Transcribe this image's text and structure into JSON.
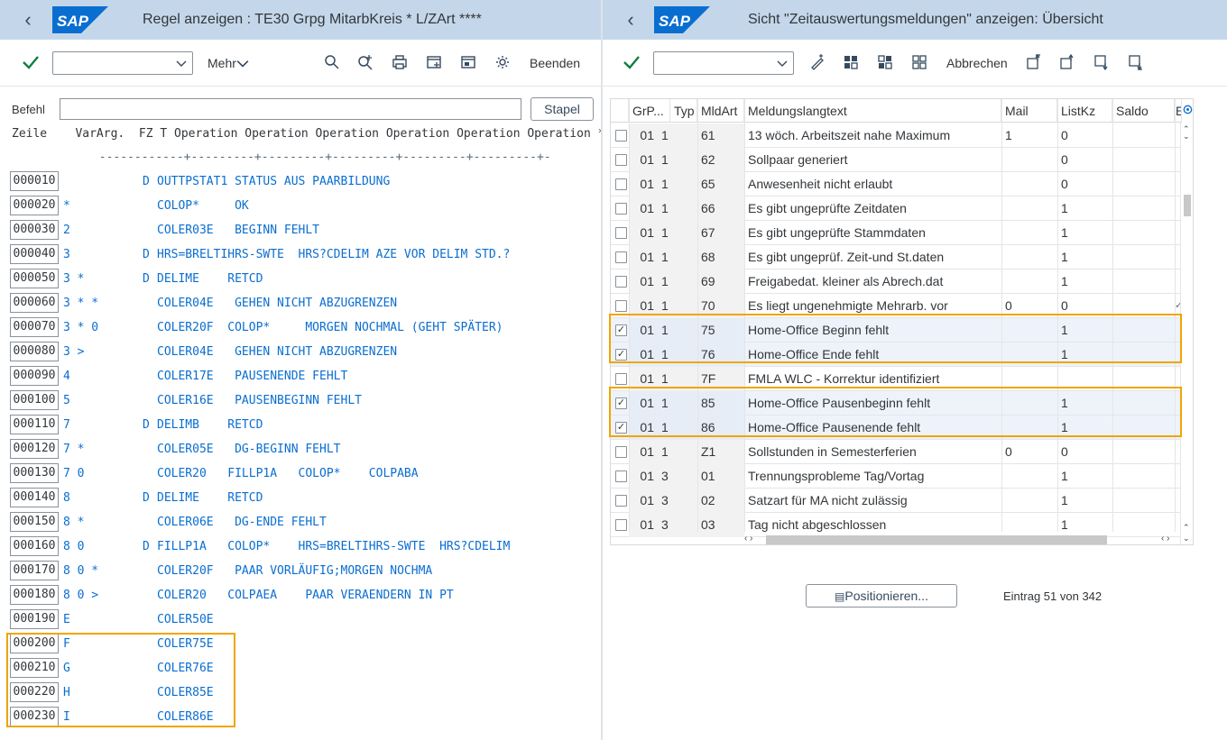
{
  "left": {
    "title": "Regel anzeigen : TE30 Grpg MitarbKreis * L/ZArt ****",
    "toolbar": {
      "more_label": "Mehr",
      "exit_label": "Beenden"
    },
    "command_label": "Befehl",
    "stapel_label": "Stapel",
    "header_line": "Zeile    VarArg.  FZ T Operation Operation Operation Operation Operation Operation *",
    "rule_line": "             ------------+---------+---------+---------+---------+---------+-",
    "rows": [
      {
        "line": "000010",
        "var": "",
        "t": "D",
        "ops": "OUTTPSTAT1 STATUS AUS PAARBILDUNG"
      },
      {
        "line": "000020",
        "var": "*",
        "t": "",
        "ops": "COLOP*     OK"
      },
      {
        "line": "000030",
        "var": "2",
        "t": "",
        "ops": "COLER03E   BEGINN FEHLT"
      },
      {
        "line": "000040",
        "var": "3",
        "t": "D",
        "ops": "HRS=BRELTIHRS-SWTE  HRS?CDELIM AZE VOR DELIM STD.?"
      },
      {
        "line": "000050",
        "var": "3 *",
        "t": "D",
        "ops": "DELIME    RETCD"
      },
      {
        "line": "000060",
        "var": "3 * *",
        "t": "",
        "ops": "COLER04E   GEHEN NICHT ABZUGRENZEN"
      },
      {
        "line": "000070",
        "var": "3 * 0",
        "t": "",
        "ops": "COLER20F  COLOP*     MORGEN NOCHMAL (GEHT SPÄTER)"
      },
      {
        "line": "000080",
        "var": "3 >",
        "t": "",
        "ops": "COLER04E   GEHEN NICHT ABZUGRENZEN"
      },
      {
        "line": "000090",
        "var": "4",
        "t": "",
        "ops": "COLER17E   PAUSENENDE FEHLT"
      },
      {
        "line": "000100",
        "var": "5",
        "t": "",
        "ops": "COLER16E   PAUSENBEGINN FEHLT"
      },
      {
        "line": "000110",
        "var": "7",
        "t": "D",
        "ops": "DELIMB    RETCD"
      },
      {
        "line": "000120",
        "var": "7 *",
        "t": "",
        "ops": "COLER05E   DG-BEGINN FEHLT"
      },
      {
        "line": "000130",
        "var": "7 0",
        "t": "",
        "ops": "COLER20   FILLP1A   COLOP*    COLPABA"
      },
      {
        "line": "000140",
        "var": "8",
        "t": "D",
        "ops": "DELIME    RETCD"
      },
      {
        "line": "000150",
        "var": "8 *",
        "t": "",
        "ops": "COLER06E   DG-ENDE FEHLT"
      },
      {
        "line": "000160",
        "var": "8 0",
        "t": "D",
        "ops": "FILLP1A   COLOP*    HRS=BRELTIHRS-SWTE  HRS?CDELIM"
      },
      {
        "line": "000170",
        "var": "8 0 *",
        "t": "",
        "ops": "COLER20F   PAAR VORLÄUFIG;MORGEN NOCHMA"
      },
      {
        "line": "000180",
        "var": "8 0 >",
        "t": "",
        "ops": "COLER20   COLPAEA    PAAR VERAENDERN IN PT"
      },
      {
        "line": "000190",
        "var": "E",
        "t": "",
        "ops": "COLER50E"
      },
      {
        "line": "000200",
        "var": "F",
        "t": "",
        "ops": "COLER75E"
      },
      {
        "line": "000210",
        "var": "G",
        "t": "",
        "ops": "COLER76E"
      },
      {
        "line": "000220",
        "var": "H",
        "t": "",
        "ops": "COLER85E"
      },
      {
        "line": "000230",
        "var": "I",
        "t": "",
        "ops": "COLER86E"
      }
    ]
  },
  "right": {
    "title": "Sicht \"Zeitauswertungsmeldungen\" anzeigen: Übersicht",
    "toolbar": {
      "cancel_label": "Abbrechen"
    },
    "columns": [
      "GrP...",
      "Typ",
      "MldArt",
      "Meldungslangtext",
      "Mail",
      "ListKz",
      "Saldo",
      "E"
    ],
    "rows": [
      {
        "checked": false,
        "grp": "01",
        "typ": "1",
        "art": "61",
        "text": "13 wöch. Arbeitszeit nahe Maximum",
        "mail": "1",
        "listkz": "0",
        "e": ""
      },
      {
        "checked": false,
        "grp": "01",
        "typ": "1",
        "art": "62",
        "text": "Sollpaar generiert",
        "mail": "",
        "listkz": "0",
        "e": ""
      },
      {
        "checked": false,
        "grp": "01",
        "typ": "1",
        "art": "65",
        "text": "Anwesenheit nicht erlaubt",
        "mail": "",
        "listkz": "0",
        "e": ""
      },
      {
        "checked": false,
        "grp": "01",
        "typ": "1",
        "art": "66",
        "text": "Es gibt ungeprüfte Zeitdaten",
        "mail": "",
        "listkz": "1",
        "e": ""
      },
      {
        "checked": false,
        "grp": "01",
        "typ": "1",
        "art": "67",
        "text": "Es gibt ungeprüfte Stammdaten",
        "mail": "",
        "listkz": "1",
        "e": ""
      },
      {
        "checked": false,
        "grp": "01",
        "typ": "1",
        "art": "68",
        "text": "Es gibt ungeprüf. Zeit-und St.daten",
        "mail": "",
        "listkz": "1",
        "e": ""
      },
      {
        "checked": false,
        "grp": "01",
        "typ": "1",
        "art": "69",
        "text": "Freigabedat. kleiner als Abrech.dat",
        "mail": "",
        "listkz": "1",
        "e": ""
      },
      {
        "checked": false,
        "grp": "01",
        "typ": "1",
        "art": "70",
        "text": "Es liegt ungenehmigte Mehrarb. vor",
        "mail": "0",
        "listkz": "0",
        "e": "✓"
      },
      {
        "checked": true,
        "grp": "01",
        "typ": "1",
        "art": "75",
        "text": "Home-Office Beginn fehlt",
        "mail": "",
        "listkz": "1",
        "e": ""
      },
      {
        "checked": true,
        "grp": "01",
        "typ": "1",
        "art": "76",
        "text": "Home-Office Ende fehlt",
        "mail": "",
        "listkz": "1",
        "e": ""
      },
      {
        "checked": false,
        "grp": "01",
        "typ": "1",
        "art": "7F",
        "text": "FMLA WLC - Korrektur identifiziert",
        "mail": "",
        "listkz": "",
        "e": ""
      },
      {
        "checked": true,
        "grp": "01",
        "typ": "1",
        "art": "85",
        "text": "Home-Office Pausenbeginn fehlt",
        "mail": "",
        "listkz": "1",
        "e": ""
      },
      {
        "checked": true,
        "grp": "01",
        "typ": "1",
        "art": "86",
        "text": "Home-Office Pausenende fehlt",
        "mail": "",
        "listkz": "1",
        "e": ""
      },
      {
        "checked": false,
        "grp": "01",
        "typ": "1",
        "art": "Z1",
        "text": "Sollstunden in Semesterferien",
        "mail": "0",
        "listkz": "0",
        "e": ""
      },
      {
        "checked": false,
        "grp": "01",
        "typ": "3",
        "art": "01",
        "text": "Trennungsprobleme Tag/Vortag",
        "mail": "",
        "listkz": "1",
        "e": ""
      },
      {
        "checked": false,
        "grp": "01",
        "typ": "3",
        "art": "02",
        "text": "Satzart für MA nicht zulässig",
        "mail": "",
        "listkz": "1",
        "e": ""
      },
      {
        "checked": false,
        "grp": "01",
        "typ": "3",
        "art": "03",
        "text": "Tag nicht abgeschlossen",
        "mail": "",
        "listkz": "1",
        "e": ""
      }
    ],
    "position_label": "Positionieren...",
    "entry_text": "Eintrag 51 von 342"
  },
  "colors": {
    "titlebar": "#c4d7ea",
    "accent": "#0a6ed1",
    "highlight": "#f0a500",
    "check_green": "#107e3e"
  }
}
